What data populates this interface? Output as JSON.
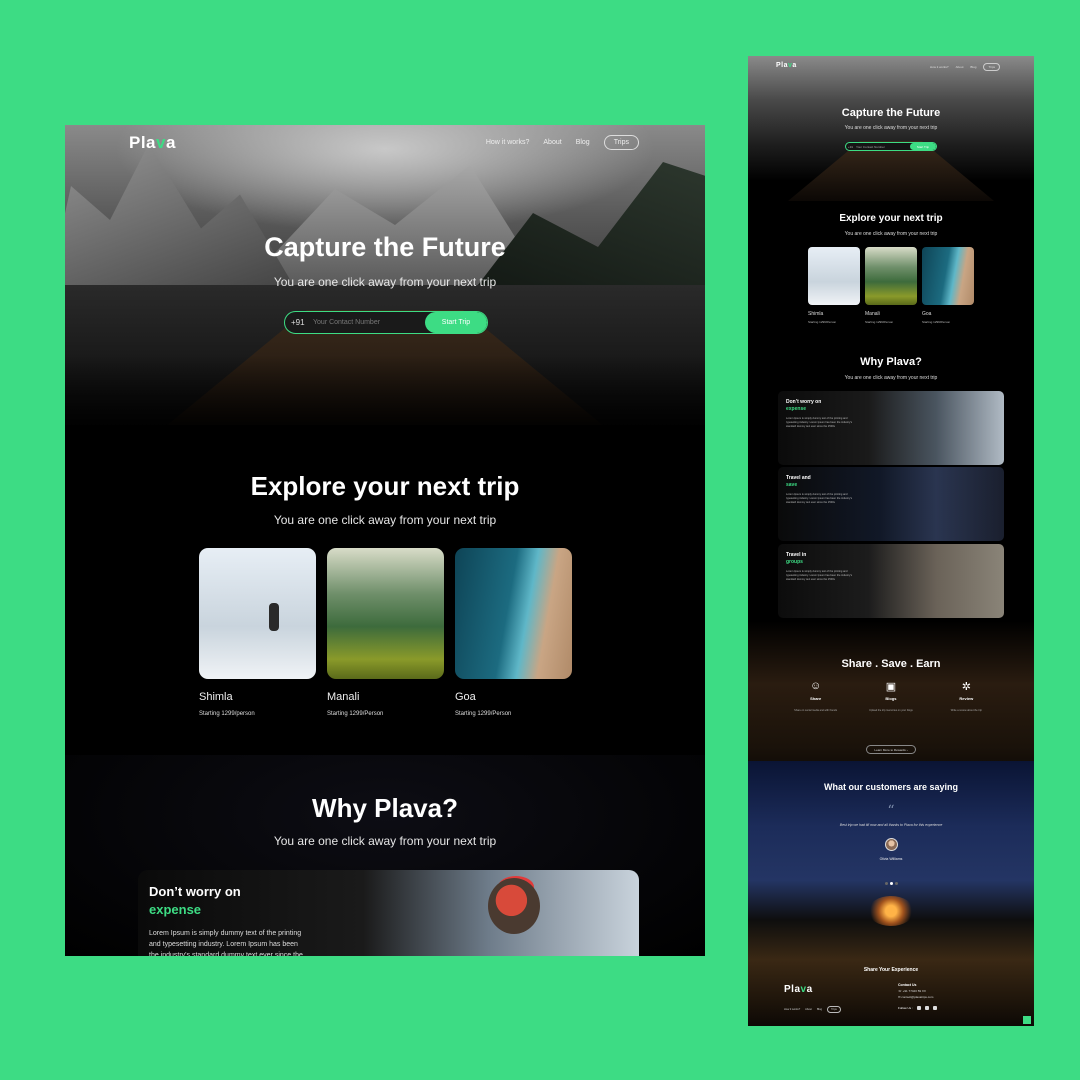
{
  "brand": {
    "logo_pre": "Pla",
    "logo_v": "v",
    "logo_post": "a",
    "accent": "#3ddc84",
    "background": "#3ddc84"
  },
  "nav": {
    "how": "How it works?",
    "about": "About",
    "blog": "Blog",
    "trips": "Trips"
  },
  "hero": {
    "title": "Capture the Future",
    "subtitle": "You are one click away from your next trip",
    "country_code": "+91",
    "phone_placeholder": "Your Contact Number",
    "start_button": "Start Trip"
  },
  "explore": {
    "title": "Explore your next trip",
    "subtitle": "You are one click away from your next trip",
    "cards": [
      {
        "name": "Shimla",
        "price": "Starting 1299/person",
        "price_small": "Starting 1299/Person"
      },
      {
        "name": "Manali",
        "price": "Starting 1299/Person",
        "price_small": "Starting 1299/Person"
      },
      {
        "name": "Goa",
        "price": "Starting 1299/Person",
        "price_small": "Starting 1299/Person"
      }
    ]
  },
  "why": {
    "title": "Why Plava?",
    "subtitle": "You are one click away from your next trip",
    "features": [
      {
        "head": "Don’t worry on",
        "accent": "expense",
        "body": "Lorem Ipsum is simply dummy text of the printing and typesetting industry. Lorem Ipsum has been the industry's standard dummy text ever since the 1500s"
      },
      {
        "head": "Travel and",
        "accent": "save",
        "body": "Lorem Ipsum is simply dummy text of the printing and typesetting industry. Lorem Ipsum has been the industry's standard dummy text ever since the 1500s"
      },
      {
        "head": "Travel in",
        "accent": "groups",
        "body": "Lorem Ipsum is simply dummy text of the printing and typesetting industry. Lorem Ipsum has been the industry's standard dummy text ever since the 1500s"
      }
    ]
  },
  "share": {
    "title": "Share . Save . Earn",
    "items": [
      {
        "label": "Share",
        "desc": "Share on social media and with friends"
      },
      {
        "label": "Blogs",
        "desc": "Upload the trip memories on your blogs"
      },
      {
        "label": "Review",
        "desc": "Write a review about the trip"
      }
    ],
    "learn_more": "Learn More to Rewards ›"
  },
  "customers": {
    "title": "What our customers are saying",
    "quote_mark": "“",
    "quote": "Best trip we had till now and all thanks to Plava for this experience",
    "name": "Olivia Williams"
  },
  "footer": {
    "share_experience": "Share Your Experience",
    "contact_title": "Contact Us",
    "phone": "+91 77420 59 XX",
    "email": "contact@plavatrips.com",
    "follow": "Follow Us :"
  }
}
